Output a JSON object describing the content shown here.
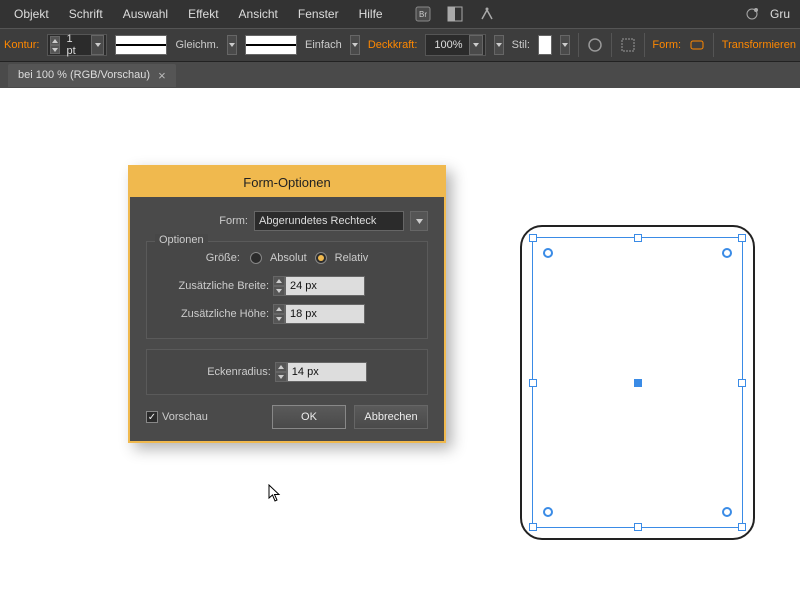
{
  "menubar": {
    "items": [
      "Objekt",
      "Schrift",
      "Auswahl",
      "Effekt",
      "Ansicht",
      "Fenster",
      "Hilfe"
    ],
    "right_label": "Gru"
  },
  "controlbar": {
    "kontur_label": "Kontur:",
    "kontur_value": "1 pt",
    "stroke_style1": "Gleichm.",
    "stroke_style2": "Einfach",
    "opacity_label": "Deckkraft:",
    "opacity_value": "100%",
    "style_label": "Stil:",
    "form_label": "Form:",
    "transform_label": "Transformieren"
  },
  "tab": {
    "title": "bei 100 % (RGB/Vorschau)"
  },
  "dialog": {
    "title": "Form-Optionen",
    "form_label": "Form:",
    "form_value": "Abgerundetes Rechteck",
    "group_label": "Optionen",
    "size_label": "Größe:",
    "radio_absolute": "Absolut",
    "radio_relative": "Relativ",
    "radio_selected": "Relativ",
    "extra_width_label": "Zusätzliche Breite:",
    "extra_width_value": "24 px",
    "extra_height_label": "Zusätzliche Höhe:",
    "extra_height_value": "18 px",
    "corner_radius_label": "Eckenradius:",
    "corner_radius_value": "14 px",
    "preview_label": "Vorschau",
    "preview_checked": true,
    "ok_label": "OK",
    "cancel_label": "Abbrechen"
  }
}
